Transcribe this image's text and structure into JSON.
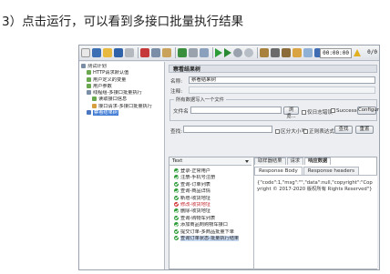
{
  "caption": "3）点击运行，可以看到多接口批量执行结果",
  "toolbar": {
    "timer": "00:00:00",
    "warn_count": "0",
    "count": "0/0"
  },
  "tree": {
    "items": [
      {
        "label": "测试计划",
        "indent": 0,
        "icon": "#7c8ea6",
        "selected": false
      },
      {
        "label": "HTTP请求默认值",
        "indent": 1,
        "icon": "#6aa84f",
        "selected": false
      },
      {
        "label": "用户定义的变量",
        "indent": 1,
        "icon": "#6aa84f",
        "selected": false
      },
      {
        "label": "用户参数",
        "indent": 1,
        "icon": "#6aa84f",
        "selected": false
      },
      {
        "label": "线程组-多接口批量执行",
        "indent": 1,
        "icon": "#7c8ea6",
        "selected": false
      },
      {
        "label": "读取接口信息",
        "indent": 2,
        "icon": "#6aa84f",
        "selected": false
      },
      {
        "label": "接口请求-多接口批量执行",
        "indent": 2,
        "icon": "#d69e3d",
        "selected": false
      },
      {
        "label": "察看结果树",
        "indent": 1,
        "icon": "#4a77c0",
        "selected": true
      }
    ]
  },
  "panel": {
    "title": "察看结果树",
    "name_label": "名称:",
    "name_value": "察看结果树",
    "comment_label": "注释:",
    "file_group_label": "所有数据写入一个文件",
    "filename_label": "文件名",
    "browse_button": "浏览...",
    "log_errors_label": "仅日志错误",
    "successes_label": "Successes",
    "configure_button": "Configure",
    "search_label": "查找:",
    "case_label": "区分大小写",
    "regex_label": "正则表达式",
    "search_button": "查找",
    "reset_button": "重置"
  },
  "results": {
    "renderer": "Text",
    "samples": [
      {
        "label": "登录-正常用户",
        "status": "ok"
      },
      {
        "label": "注册-手机号注册",
        "status": "ok"
      },
      {
        "label": "查询-订单列表",
        "status": "ok"
      },
      {
        "label": "查询-商品详情",
        "status": "ok"
      },
      {
        "label": "新增-收货地址",
        "status": "ok"
      },
      {
        "label": "修改-收货地址",
        "status": "err"
      },
      {
        "label": "删除-收货地址",
        "status": "ok"
      },
      {
        "label": "查询-购物车列表",
        "status": "ok"
      },
      {
        "label": "添加商品到购物车接口",
        "status": "ok"
      },
      {
        "label": "提交订单-多商品批量下单",
        "status": "ok"
      },
      {
        "label": "查询订单状态-批量执行结果",
        "status": "ok",
        "selected": true
      }
    ],
    "tabs_top": [
      "取样器结果",
      "请求",
      "响应数据"
    ],
    "tabs_sub": [
      "Response Body",
      "Response headers"
    ],
    "response_body": "{\"code\":1,\"msg\":\"\",\"data\":null,\"copyright\":\"Copyright © 2017-2020 版权所有 Rights Reserved\"}"
  },
  "colors": {
    "ok": "#2e9d3a",
    "err": "#d23a3a"
  }
}
